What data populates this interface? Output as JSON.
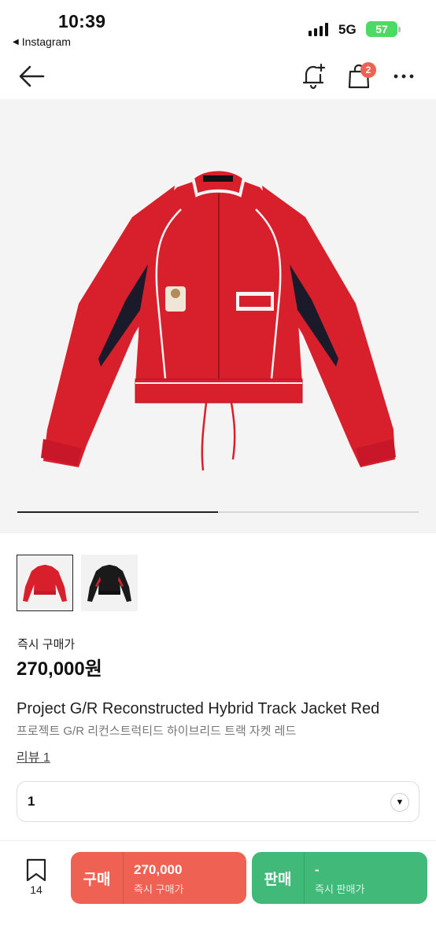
{
  "status_bar": {
    "time": "10:39",
    "back_app": "Instagram",
    "network": "5G",
    "battery": "57"
  },
  "nav": {
    "back_icon": "arrow-left-icon",
    "bell_icon": "bell-plus-icon",
    "cart_icon": "shopping-bag-icon",
    "cart_badge": "2",
    "more_icon": "more-horizontal-icon"
  },
  "gallery": {
    "progress_fraction": 0.5,
    "thumbnails": [
      {
        "color": "red",
        "active": true
      },
      {
        "color": "black",
        "active": false
      }
    ]
  },
  "product": {
    "price_label": "즉시 구매가",
    "price": "270,000원",
    "title_en": "Project G/R Reconstructed Hybrid Track Jacket Red",
    "title_ko": "프로젝트 G/R 리컨스트럭티드 하이브리드 트랙 자켓 레드",
    "review_link": "리뷰 1"
  },
  "quantity": {
    "selected": "1"
  },
  "bottom_bar": {
    "wish_count": "14",
    "buy": {
      "label": "구매",
      "price": "270,000",
      "sub": "즉시 구매가"
    },
    "sell": {
      "label": "판매",
      "price": "-",
      "sub": "즉시 판매가"
    }
  },
  "colors": {
    "buy": "#ef6253",
    "sell": "#41b979",
    "jacket_red": "#d81f2c",
    "jacket_black": "#1a1a1a"
  }
}
